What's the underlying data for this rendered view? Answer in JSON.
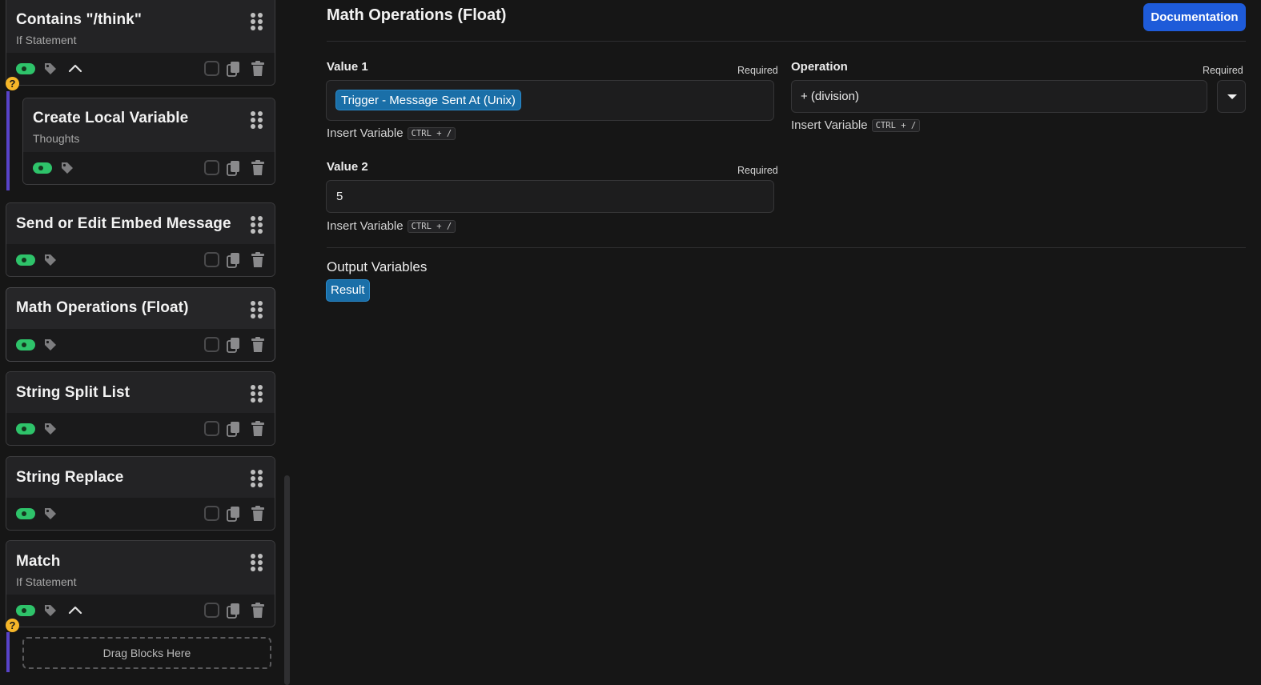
{
  "blocks": [
    {
      "title": "Contains \"/think\"",
      "subtitle": "If Statement",
      "enabled": true,
      "icons": [
        "toggle-icon",
        "tag-icon",
        "chevron-up-icon",
        "checkbox-icon",
        "copy-icon",
        "trash-icon"
      ]
    },
    {
      "title": "Create Local Variable",
      "subtitle": "Thoughts",
      "enabled": true,
      "icons": [
        "toggle-icon",
        "tag-icon",
        "checkbox-icon",
        "copy-icon",
        "trash-icon"
      ]
    },
    {
      "title": "Send or Edit Embed Message",
      "subtitle": "",
      "enabled": true,
      "icons": [
        "toggle-icon",
        "tag-icon",
        "checkbox-icon",
        "copy-icon",
        "trash-icon"
      ]
    },
    {
      "title": "Math Operations (Float)",
      "subtitle": "",
      "enabled": true,
      "icons": [
        "toggle-icon",
        "tag-icon",
        "checkbox-icon",
        "copy-icon",
        "trash-icon"
      ]
    },
    {
      "title": "String Split List",
      "subtitle": "",
      "enabled": true,
      "icons": [
        "toggle-icon",
        "tag-icon",
        "checkbox-icon",
        "copy-icon",
        "trash-icon"
      ]
    },
    {
      "title": "String Replace",
      "subtitle": "",
      "enabled": true,
      "icons": [
        "toggle-icon",
        "tag-icon",
        "checkbox-icon",
        "copy-icon",
        "trash-icon"
      ]
    },
    {
      "title": "Match",
      "subtitle": "If Statement",
      "enabled": true,
      "icons": [
        "toggle-icon",
        "tag-icon",
        "chevron-up-icon",
        "checkbox-icon",
        "copy-icon",
        "trash-icon"
      ]
    }
  ],
  "help_badge": "?",
  "dropzone_label": "Drag Blocks Here",
  "panel": {
    "title": "Math Operations (Float)",
    "documentation_label": "Documentation",
    "value1": {
      "label": "Value 1",
      "required": "Required",
      "variable_chip": "Trigger - Message Sent At (Unix)",
      "insert_label": "Insert Variable",
      "shortcut": "CTRL + /"
    },
    "operation": {
      "label": "Operation",
      "required": "Required",
      "value": "+ (division)",
      "insert_label": "Insert Variable",
      "shortcut": "CTRL + /"
    },
    "value2": {
      "label": "Value 2",
      "required": "Required",
      "value": "5",
      "insert_label": "Insert Variable",
      "shortcut": "CTRL + /"
    },
    "output_title": "Output Variables",
    "output_chip": "Result"
  },
  "colors": {
    "accent": "#1e5bd9",
    "chip": "#1a6fa8",
    "toggle_on": "#2ec36a",
    "nest_line": "#5843c9",
    "help": "#f5b629"
  }
}
